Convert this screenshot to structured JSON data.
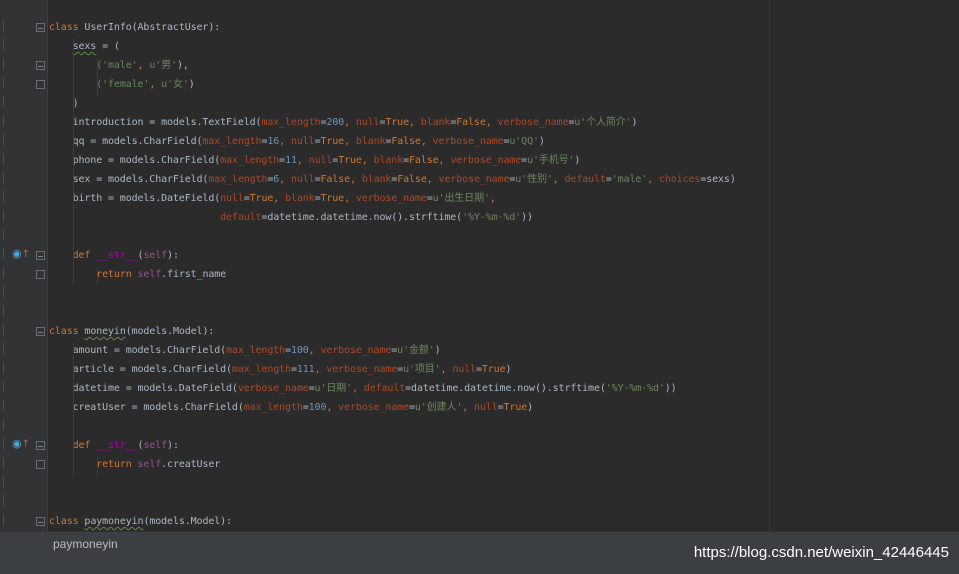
{
  "code": {
    "lines": [
      {
        "segments": [
          {
            "t": "class",
            "c": "kw"
          },
          {
            "t": " UserInfo(AbstractUser):",
            "c": "ident"
          }
        ]
      },
      {
        "segments": [
          {
            "t": "    ",
            "c": "ident"
          },
          {
            "t": "sexs",
            "c": "ident squig"
          },
          {
            "t": " = (",
            "c": "ident"
          }
        ]
      },
      {
        "segments": [
          {
            "t": "        ",
            "c": "ident"
          },
          {
            "t": "('male'",
            "c": "str"
          },
          {
            "t": ", ",
            "c": "kw"
          },
          {
            "t": "u'男'",
            "c": "str"
          },
          {
            "t": "),",
            "c": "ident"
          }
        ]
      },
      {
        "segments": [
          {
            "t": "        ",
            "c": "ident"
          },
          {
            "t": "('female'",
            "c": "str"
          },
          {
            "t": ", ",
            "c": "kw"
          },
          {
            "t": "u'女'",
            "c": "str"
          },
          {
            "t": ")",
            "c": "ident"
          }
        ]
      },
      {
        "segments": [
          {
            "t": "    )",
            "c": "ident"
          }
        ]
      },
      {
        "segments": [
          {
            "t": "    introduction = models.TextField(",
            "c": "ident"
          },
          {
            "t": "max_length",
            "c": "param"
          },
          {
            "t": "=",
            "c": "ident"
          },
          {
            "t": "200",
            "c": "num"
          },
          {
            "t": ", ",
            "c": "kw"
          },
          {
            "t": "null",
            "c": "param"
          },
          {
            "t": "=",
            "c": "ident"
          },
          {
            "t": "True",
            "c": "kw"
          },
          {
            "t": ", ",
            "c": "kw"
          },
          {
            "t": "blank",
            "c": "param"
          },
          {
            "t": "=",
            "c": "ident"
          },
          {
            "t": "False",
            "c": "kw"
          },
          {
            "t": ", ",
            "c": "kw"
          },
          {
            "t": "verbose_name",
            "c": "param"
          },
          {
            "t": "=",
            "c": "ident"
          },
          {
            "t": "u'个人简介'",
            "c": "str"
          },
          {
            "t": ")",
            "c": "ident"
          }
        ]
      },
      {
        "segments": [
          {
            "t": "    qq = models.CharField(",
            "c": "ident"
          },
          {
            "t": "max_length",
            "c": "param"
          },
          {
            "t": "=",
            "c": "ident"
          },
          {
            "t": "16",
            "c": "num"
          },
          {
            "t": ", ",
            "c": "kw"
          },
          {
            "t": "null",
            "c": "param"
          },
          {
            "t": "=",
            "c": "ident"
          },
          {
            "t": "True",
            "c": "kw"
          },
          {
            "t": ", ",
            "c": "kw"
          },
          {
            "t": "blank",
            "c": "param"
          },
          {
            "t": "=",
            "c": "ident"
          },
          {
            "t": "False",
            "c": "kw"
          },
          {
            "t": ", ",
            "c": "kw"
          },
          {
            "t": "verbose_name",
            "c": "param"
          },
          {
            "t": "=",
            "c": "ident"
          },
          {
            "t": "u'QQ'",
            "c": "str"
          },
          {
            "t": ")",
            "c": "ident"
          }
        ]
      },
      {
        "segments": [
          {
            "t": "    phone = models.CharField(",
            "c": "ident"
          },
          {
            "t": "max_length",
            "c": "param"
          },
          {
            "t": "=",
            "c": "ident"
          },
          {
            "t": "11",
            "c": "num"
          },
          {
            "t": ", ",
            "c": "kw"
          },
          {
            "t": "null",
            "c": "param"
          },
          {
            "t": "=",
            "c": "ident"
          },
          {
            "t": "True",
            "c": "kw"
          },
          {
            "t": ", ",
            "c": "kw"
          },
          {
            "t": "blank",
            "c": "param"
          },
          {
            "t": "=",
            "c": "ident"
          },
          {
            "t": "False",
            "c": "kw"
          },
          {
            "t": ", ",
            "c": "kw"
          },
          {
            "t": "verbose_name",
            "c": "param"
          },
          {
            "t": "=",
            "c": "ident"
          },
          {
            "t": "u'手机号'",
            "c": "str"
          },
          {
            "t": ")",
            "c": "ident"
          }
        ]
      },
      {
        "segments": [
          {
            "t": "    sex = models.CharField(",
            "c": "ident"
          },
          {
            "t": "max_length",
            "c": "param"
          },
          {
            "t": "=",
            "c": "ident"
          },
          {
            "t": "6",
            "c": "num"
          },
          {
            "t": ", ",
            "c": "kw"
          },
          {
            "t": "null",
            "c": "param"
          },
          {
            "t": "=",
            "c": "ident"
          },
          {
            "t": "False",
            "c": "kw"
          },
          {
            "t": ", ",
            "c": "kw"
          },
          {
            "t": "blank",
            "c": "param"
          },
          {
            "t": "=",
            "c": "ident"
          },
          {
            "t": "False",
            "c": "kw"
          },
          {
            "t": ", ",
            "c": "kw"
          },
          {
            "t": "verbose_name",
            "c": "param"
          },
          {
            "t": "=",
            "c": "ident"
          },
          {
            "t": "u'性别'",
            "c": "str"
          },
          {
            "t": ", ",
            "c": "kw"
          },
          {
            "t": "default",
            "c": "param"
          },
          {
            "t": "=",
            "c": "ident"
          },
          {
            "t": "'male'",
            "c": "str"
          },
          {
            "t": ", ",
            "c": "kw"
          },
          {
            "t": "choices",
            "c": "param"
          },
          {
            "t": "=sexs)",
            "c": "ident"
          }
        ]
      },
      {
        "segments": [
          {
            "t": "    birth = models.DateField(",
            "c": "ident"
          },
          {
            "t": "null",
            "c": "param"
          },
          {
            "t": "=",
            "c": "ident"
          },
          {
            "t": "True",
            "c": "kw"
          },
          {
            "t": ", ",
            "c": "kw"
          },
          {
            "t": "blank",
            "c": "param"
          },
          {
            "t": "=",
            "c": "ident"
          },
          {
            "t": "True",
            "c": "kw"
          },
          {
            "t": ", ",
            "c": "kw"
          },
          {
            "t": "verbose_name",
            "c": "param"
          },
          {
            "t": "=",
            "c": "ident"
          },
          {
            "t": "u'出生日期'",
            "c": "str"
          },
          {
            "t": ",",
            "c": "kw"
          }
        ]
      },
      {
        "segments": [
          {
            "t": "                             ",
            "c": "ident"
          },
          {
            "t": "default",
            "c": "param"
          },
          {
            "t": "=datetime.datetime.now().strftime(",
            "c": "ident"
          },
          {
            "t": "'%Y-%m-%d'",
            "c": "str"
          },
          {
            "t": "))",
            "c": "ident"
          }
        ]
      },
      {
        "segments": []
      },
      {
        "segments": [
          {
            "t": "    ",
            "c": "ident"
          },
          {
            "t": "def",
            "c": "kw"
          },
          {
            "t": " ",
            "c": "ident"
          },
          {
            "t": "__str__",
            "c": "magic"
          },
          {
            "t": "(",
            "c": "ident"
          },
          {
            "t": "self",
            "c": "selfkw"
          },
          {
            "t": "):",
            "c": "ident"
          }
        ]
      },
      {
        "segments": [
          {
            "t": "        ",
            "c": "ident"
          },
          {
            "t": "return",
            "c": "kw"
          },
          {
            "t": " ",
            "c": "ident"
          },
          {
            "t": "self",
            "c": "selfkw"
          },
          {
            "t": ".first_name",
            "c": "ident"
          }
        ]
      },
      {
        "segments": []
      },
      {
        "segments": []
      },
      {
        "segments": [
          {
            "t": "class",
            "c": "kw"
          },
          {
            "t": " ",
            "c": "ident"
          },
          {
            "t": "moneyin",
            "c": "ident squig"
          },
          {
            "t": "(models.Model):",
            "c": "ident"
          }
        ]
      },
      {
        "segments": [
          {
            "t": "    amount = models.CharField(",
            "c": "ident"
          },
          {
            "t": "max_length",
            "c": "param"
          },
          {
            "t": "=",
            "c": "ident"
          },
          {
            "t": "100",
            "c": "num"
          },
          {
            "t": ", ",
            "c": "kw"
          },
          {
            "t": "verbose_name",
            "c": "param"
          },
          {
            "t": "=",
            "c": "ident"
          },
          {
            "t": "u'金额'",
            "c": "str"
          },
          {
            "t": ")",
            "c": "ident"
          }
        ]
      },
      {
        "segments": [
          {
            "t": "    article = models.CharField(",
            "c": "ident"
          },
          {
            "t": "max_length",
            "c": "param"
          },
          {
            "t": "=",
            "c": "ident"
          },
          {
            "t": "111",
            "c": "num"
          },
          {
            "t": ", ",
            "c": "kw"
          },
          {
            "t": "verbose_name",
            "c": "param"
          },
          {
            "t": "=",
            "c": "ident"
          },
          {
            "t": "u'项目'",
            "c": "str"
          },
          {
            "t": ", ",
            "c": "kw"
          },
          {
            "t": "null",
            "c": "param"
          },
          {
            "t": "=",
            "c": "ident"
          },
          {
            "t": "True",
            "c": "kw"
          },
          {
            "t": ")",
            "c": "ident"
          }
        ]
      },
      {
        "segments": [
          {
            "t": "    datetime = models.DateField(",
            "c": "ident"
          },
          {
            "t": "verbose_name",
            "c": "param"
          },
          {
            "t": "=",
            "c": "ident"
          },
          {
            "t": "u'日期'",
            "c": "str"
          },
          {
            "t": ", ",
            "c": "kw"
          },
          {
            "t": "default",
            "c": "param"
          },
          {
            "t": "=datetime.datetime.now().strftime(",
            "c": "ident"
          },
          {
            "t": "'%Y-%m-%d'",
            "c": "str"
          },
          {
            "t": "))",
            "c": "ident"
          }
        ]
      },
      {
        "segments": [
          {
            "t": "    creatUser = models.CharField(",
            "c": "ident"
          },
          {
            "t": "max_length",
            "c": "param"
          },
          {
            "t": "=",
            "c": "ident"
          },
          {
            "t": "100",
            "c": "num"
          },
          {
            "t": ", ",
            "c": "kw"
          },
          {
            "t": "verbose_name",
            "c": "param"
          },
          {
            "t": "=",
            "c": "ident"
          },
          {
            "t": "u'创建人'",
            "c": "str"
          },
          {
            "t": ", ",
            "c": "kw"
          },
          {
            "t": "null",
            "c": "param"
          },
          {
            "t": "=",
            "c": "ident"
          },
          {
            "t": "True",
            "c": "kw"
          },
          {
            "t": ")",
            "c": "ident"
          }
        ]
      },
      {
        "segments": []
      },
      {
        "segments": [
          {
            "t": "    ",
            "c": "ident"
          },
          {
            "t": "def",
            "c": "kw"
          },
          {
            "t": " ",
            "c": "ident"
          },
          {
            "t": "__str__",
            "c": "magic"
          },
          {
            "t": "(",
            "c": "ident"
          },
          {
            "t": "self",
            "c": "selfkw"
          },
          {
            "t": "):",
            "c": "ident"
          }
        ]
      },
      {
        "segments": [
          {
            "t": "        ",
            "c": "ident"
          },
          {
            "t": "return",
            "c": "kw"
          },
          {
            "t": " ",
            "c": "ident"
          },
          {
            "t": "self",
            "c": "selfkw"
          },
          {
            "t": ".creatUser",
            "c": "ident"
          }
        ]
      },
      {
        "segments": []
      },
      {
        "segments": []
      },
      {
        "segments": [
          {
            "t": "class",
            "c": "kw"
          },
          {
            "t": " ",
            "c": "ident"
          },
          {
            "t": "paymoneyin",
            "c": "ident squig"
          },
          {
            "t": "(models.Model):",
            "c": "ident"
          }
        ]
      }
    ]
  },
  "gutter": {
    "fold_markers": [
      {
        "line": 0,
        "state": "open"
      },
      {
        "line": 2,
        "state": "open"
      },
      {
        "line": 3,
        "state": "closed"
      },
      {
        "line": 12,
        "state": "open"
      },
      {
        "line": 13,
        "state": "closed"
      },
      {
        "line": 16,
        "state": "open"
      },
      {
        "line": 22,
        "state": "open"
      },
      {
        "line": 23,
        "state": "closed"
      },
      {
        "line": 26,
        "state": "open"
      }
    ],
    "override_markers": [
      {
        "line": 12,
        "icon": "override-method-icon"
      },
      {
        "line": 22,
        "icon": "override-method-icon"
      }
    ]
  },
  "status": {
    "breadcrumb": "paymoneyin"
  },
  "watermark": {
    "text": "https://blog.csdn.net/weixin_42446445"
  },
  "theme": {
    "background": "#2b2b2b",
    "keyword": "#cc7832",
    "string": "#6a8759",
    "number": "#6897bb",
    "param": "#aa4926",
    "magic": "#b200b2",
    "self": "#94558d",
    "text": "#a9b7c6"
  }
}
